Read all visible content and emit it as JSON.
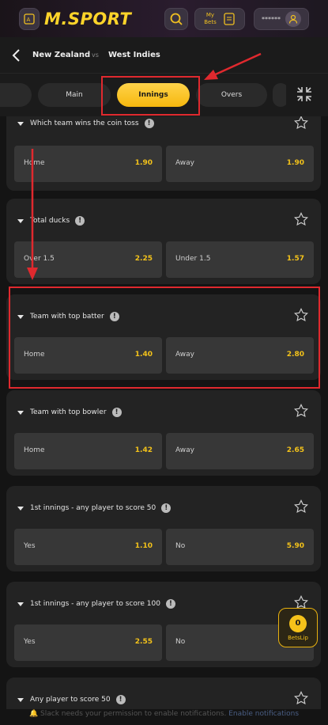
{
  "header": {
    "brand": "M.SPORT",
    "my_bets": "My\nBets",
    "balance_masked": "******"
  },
  "match": {
    "team_a": "New Zealand",
    "vs": "vs",
    "team_b": "West Indies"
  },
  "tabs": [
    {
      "label": "Main",
      "active": false
    },
    {
      "label": "Innings",
      "active": true
    },
    {
      "label": "Overs",
      "active": false
    }
  ],
  "markets": [
    {
      "title": "Which team wins the coin toss",
      "options": [
        {
          "label": "Home",
          "odds": "1.90"
        },
        {
          "label": "Away",
          "odds": "1.90"
        }
      ]
    },
    {
      "title": "Total ducks",
      "options": [
        {
          "label": "Over 1.5",
          "odds": "2.25"
        },
        {
          "label": "Under 1.5",
          "odds": "1.57"
        }
      ]
    },
    {
      "title": "Team with top batter",
      "options": [
        {
          "label": "Home",
          "odds": "1.40"
        },
        {
          "label": "Away",
          "odds": "2.80"
        }
      ]
    },
    {
      "title": "Team with top bowler",
      "options": [
        {
          "label": "Home",
          "odds": "1.42"
        },
        {
          "label": "Away",
          "odds": "2.65"
        }
      ]
    },
    {
      "title": "1st innings - any player to score 50",
      "options": [
        {
          "label": "Yes",
          "odds": "1.10"
        },
        {
          "label": "No",
          "odds": "5.90"
        }
      ]
    },
    {
      "title": "1st innings - any player to score 100",
      "options": [
        {
          "label": "Yes",
          "odds": "2.55"
        },
        {
          "label": "No",
          "odds": ""
        }
      ]
    },
    {
      "title": "Any player to score 50",
      "options": []
    }
  ],
  "betslip": {
    "count": "0",
    "label": "BetsLip"
  },
  "notification": {
    "text": "Slack needs your permission to enable notifications.",
    "link": "Enable notifications"
  },
  "colors": {
    "accent": "#f5c21a",
    "annotation": "#e0292e",
    "card": "#232323",
    "option": "#373737"
  }
}
